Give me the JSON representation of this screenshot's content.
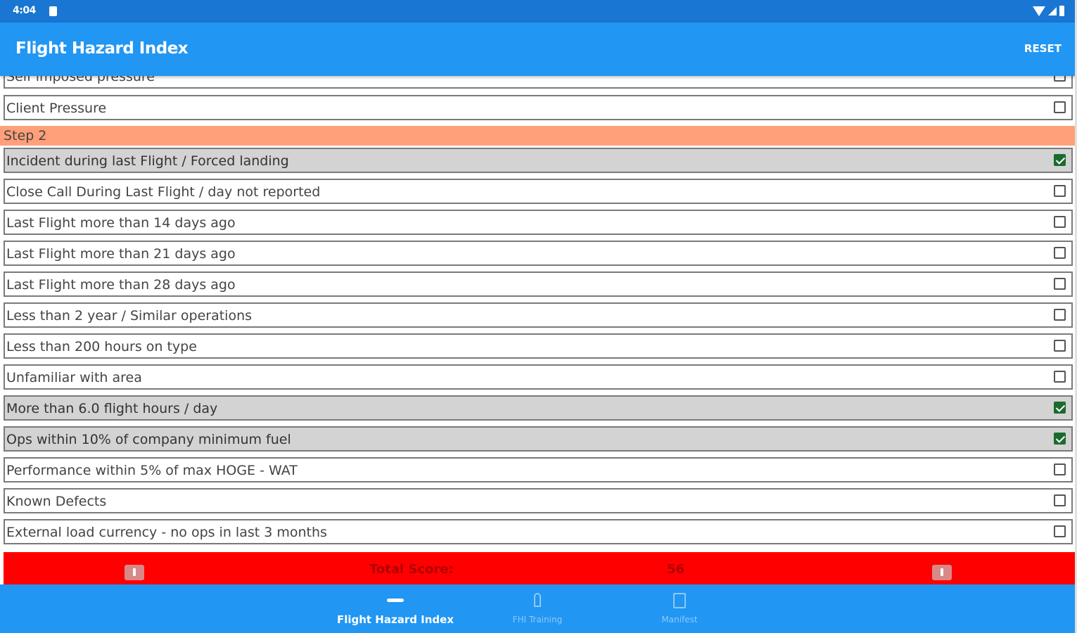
{
  "status_bar": {
    "time": "4:04"
  },
  "app_bar": {
    "title": "Flight Hazard Index",
    "reset_label": "RESET"
  },
  "list": {
    "partial_top_item": {
      "label": "Self imposed pressure",
      "checked": false
    },
    "step1_items": [
      {
        "label": "Client Pressure",
        "checked": false
      }
    ],
    "step2_header": "Step 2",
    "step2_items": [
      {
        "label": "Incident during last Flight / Forced landing",
        "checked": true
      },
      {
        "label": "Close Call During Last Flight / day not reported",
        "checked": false
      },
      {
        "label": "Last Flight more than 14 days ago",
        "checked": false
      },
      {
        "label": "Last Flight more than 21 days ago",
        "checked": false
      },
      {
        "label": "Last Flight more than 28 days ago",
        "checked": false
      },
      {
        "label": "Less than 2 year / Similar operations",
        "checked": false
      },
      {
        "label": "Less than 200 hours on type",
        "checked": false
      },
      {
        "label": "Unfamiliar with area",
        "checked": false
      },
      {
        "label": "More than 6.0 flight hours / day",
        "checked": true
      },
      {
        "label": "Ops within 10% of company minimum fuel",
        "checked": true
      },
      {
        "label": "Performance within 5% of max HOGE - WAT",
        "checked": false
      },
      {
        "label": "Known Defects",
        "checked": false
      },
      {
        "label": "External load currency - no ops in last 3 months",
        "checked": false
      }
    ]
  },
  "score_bar": {
    "label": "Total Score:",
    "value": "56",
    "left_icon": "info-icon",
    "right_icon": "info-icon"
  },
  "bottom_nav": {
    "items": [
      {
        "label": "Flight Hazard Index",
        "icon": "helicopter-icon",
        "active": true
      },
      {
        "label": "FHI Training",
        "icon": "person-icon",
        "active": false
      },
      {
        "label": "Manifest",
        "icon": "document-icon",
        "active": false
      }
    ]
  },
  "colors": {
    "status_bar": "#1976d2",
    "app_bar": "#2196f3",
    "step_header": "#ffa07a",
    "checked_row": "#d3d3d3",
    "checkbox_checked": "#1a6b2e",
    "score_bar": "#ff0000"
  }
}
